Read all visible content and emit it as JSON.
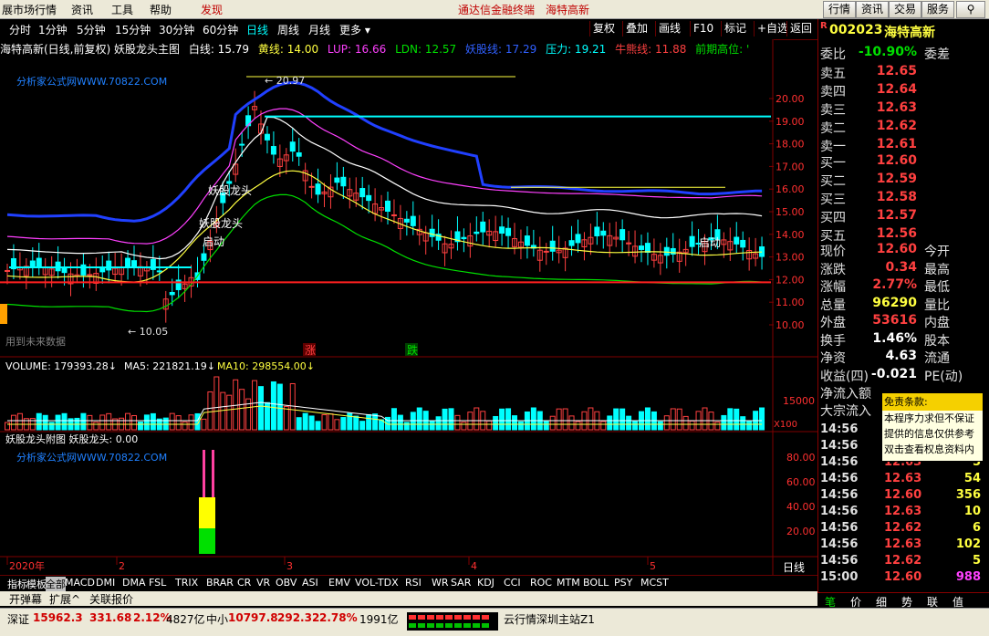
{
  "menubar": {
    "items": [
      "展市场行情",
      "资讯",
      "工具",
      "帮助",
      "发现"
    ],
    "center_text": "通达信金融终端",
    "stock_title": "海特高新",
    "right_buttons": [
      "行情",
      "资讯",
      "交易",
      "服务"
    ]
  },
  "toolbar": {
    "periods": [
      "分时",
      "1分钟",
      "5分钟",
      "15分钟",
      "30分钟",
      "60分钟",
      "日线",
      "周线",
      "月线",
      "更多"
    ],
    "active_period": "日线",
    "right_buttons": [
      "复权",
      "叠加",
      "画线",
      "F10",
      "标记",
      "+自选",
      "返回"
    ]
  },
  "infoline": {
    "title": "海特高新(日线,前复权) 妖股龙头主图",
    "items": [
      {
        "text": "白线: 15.79",
        "color": "#ffffff"
      },
      {
        "text": "黄线: 14.00",
        "color": "#ffff40"
      },
      {
        "text": "LUP: 16.66",
        "color": "#ff40ff"
      },
      {
        "text": "LDN: 12.57",
        "color": "#00e000"
      },
      {
        "text": "妖股线: 17.29",
        "color": "#3060ff"
      },
      {
        "text": "压力: 19.21",
        "color": "#00ffff"
      },
      {
        "text": "牛熊线: 11.88",
        "color": "#ff4040"
      },
      {
        "text": "前期高位: '",
        "color": "#00e000"
      }
    ]
  },
  "main_chart": {
    "watermark": "分析家公式网WWW.70822.COM",
    "future_data_label": "用到未来数据",
    "high_label": "20.97",
    "low_label": "10.05",
    "annotations": [
      "妖股龙头",
      "妖股龙头",
      "启动",
      "启动"
    ],
    "signal_up": "涨",
    "signal_down": "跌",
    "y_ticks": [
      "20.00",
      "19.00",
      "18.00",
      "17.00",
      "16.00",
      "15.00",
      "14.00",
      "13.00",
      "12.00",
      "11.00",
      "10.00"
    ]
  },
  "volume_panel": {
    "title": "VOLUME: 179393.28",
    "ma5": "MA5: 221821.19",
    "ma10": "MA10: 298554.00",
    "y_tick": "15000",
    "unit": "X100"
  },
  "sub_panel": {
    "title": "妖股龙头附图 妖股龙头: 0.00",
    "watermark": "分析家公式网WWW.70822.COM",
    "y_ticks": [
      "80.00",
      "60.00",
      "40.00",
      "20.00"
    ]
  },
  "x_axis": {
    "labels": [
      "2020年",
      "2",
      "3",
      "4",
      "5"
    ],
    "period_label": "日线"
  },
  "indicator_bar": {
    "items": [
      "指标",
      "模板",
      "全部",
      "MACD",
      "DMI",
      "DMA",
      "FSL",
      "TRIX",
      "BRAR",
      "CR",
      "VR",
      "OBV",
      "ASI",
      "EMV",
      "VOL-TDX",
      "RSI",
      "WR",
      "SAR",
      "KDJ",
      "CCI",
      "ROC",
      "MTM",
      "BOLL",
      "PSY",
      "MCST"
    ],
    "active": "全部"
  },
  "bottom_tabs": [
    "开弹幕",
    "扩展^",
    "关联报价"
  ],
  "quote": {
    "code": "002023",
    "name": "海特高新",
    "weibi_label": "委比",
    "weibi_value": "-10.90%",
    "weicha_label": "委差",
    "asks": [
      {
        "label": "卖五",
        "price": "12.65"
      },
      {
        "label": "卖四",
        "price": "12.64"
      },
      {
        "label": "卖三",
        "price": "12.63"
      },
      {
        "label": "卖二",
        "price": "12.62"
      },
      {
        "label": "卖一",
        "price": "12.61"
      }
    ],
    "bids": [
      {
        "label": "买一",
        "price": "12.60"
      },
      {
        "label": "买二",
        "price": "12.59"
      },
      {
        "label": "买三",
        "price": "12.58"
      },
      {
        "label": "买四",
        "price": "12.57"
      },
      {
        "label": "买五",
        "price": "12.56"
      }
    ],
    "stats": [
      {
        "label": "现价",
        "value": "12.60",
        "right": "今开",
        "cls": "up"
      },
      {
        "label": "涨跌",
        "value": "0.34",
        "right": "最高",
        "cls": "up"
      },
      {
        "label": "涨幅",
        "value": "2.77%",
        "right": "最低",
        "cls": "up"
      },
      {
        "label": "总量",
        "value": "96290",
        "right": "量比",
        "cls": "yel"
      },
      {
        "label": "外盘",
        "value": "53616",
        "right": "内盘",
        "cls": "up"
      },
      {
        "label": "换手",
        "value": "1.46%",
        "right": "股本",
        "cls": "wht"
      },
      {
        "label": "净资",
        "value": "4.63",
        "right": "流通",
        "cls": "wht"
      },
      {
        "label": "收益(四)",
        "value": "-0.021",
        "right": "PE(动)",
        "cls": "wht"
      }
    ],
    "net_inflow_label": "净流入额",
    "big_inflow_label": "大宗流入"
  },
  "disclaimer": {
    "title": "免责条款:",
    "lines": [
      "本程序力求但不保证",
      "提供的信息仅供参考",
      "双击查看权息资料内"
    ]
  },
  "ticks": [
    {
      "time": "14:56",
      "price": "",
      "vol": ""
    },
    {
      "time": "14:56",
      "price": "",
      "vol": ""
    },
    {
      "time": "14:56",
      "price": "12.63",
      "vol": "5"
    },
    {
      "time": "14:56",
      "price": "12.63",
      "vol": "54"
    },
    {
      "time": "14:56",
      "price": "12.60",
      "vol": "356"
    },
    {
      "time": "14:56",
      "price": "12.63",
      "vol": "10"
    },
    {
      "time": "14:56",
      "price": "12.62",
      "vol": "6"
    },
    {
      "time": "14:56",
      "price": "12.63",
      "vol": "102"
    },
    {
      "time": "14:56",
      "price": "12.62",
      "vol": "5"
    },
    {
      "time": "15:00",
      "price": "12.60",
      "vol": "988"
    }
  ],
  "right_tabs": [
    "笔",
    "价",
    "细",
    "势",
    "联",
    "值"
  ],
  "status": {
    "sz_label": "深证",
    "sz_value": "15962.3",
    "sz_change": "331.68",
    "sz_pct": "2.12%",
    "sz_amount": "4827亿",
    "zx_label": "中小",
    "zx_value": "10797.8",
    "zx_change": "292.32",
    "zx_pct": "2.78%",
    "zx_amount": "1991亿",
    "server": "云行情深圳主站Z1"
  },
  "colors": {
    "up": "#ff4040",
    "down": "#00e000",
    "accent": "#ffff40"
  }
}
